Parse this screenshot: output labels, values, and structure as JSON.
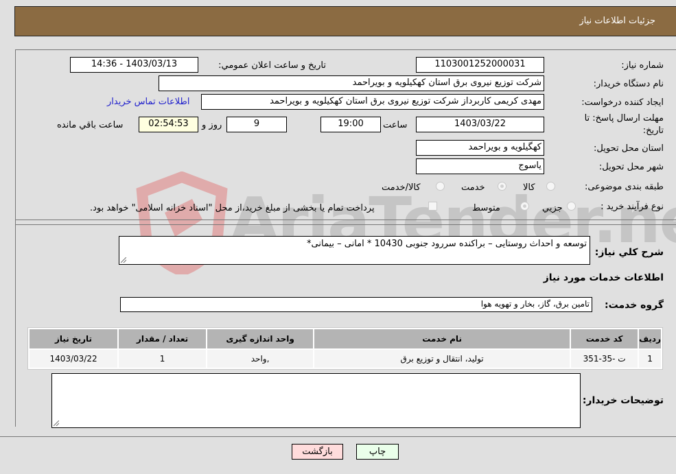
{
  "header": {
    "title": "جزئیات اطلاعات نیاز"
  },
  "form": {
    "need_number_label": "شماره نیاز:",
    "need_number": "1103001252000031",
    "announce_label": "تاریخ و ساعت اعلان عمومي:",
    "announce_value": "1403/03/13 - 14:36",
    "buyer_org_label": "نام دستگاه خریدار:",
    "buyer_org": "شرکت توزیع نیروی برق استان کهکیلویه و بویراحمد",
    "creator_label": "ایجاد کننده درخواست:",
    "creator": "مهدی کریمی کاربرداز شرکت توزیع نیروی برق استان کهکیلویه و بویراحمد",
    "contact_link": "اطلاعات تماس خریدار",
    "deadline_label_1": "مهلت ارسال پاسخ: تا",
    "deadline_label_2": "تاریخ:",
    "deadline_date": "1403/03/22",
    "time_label": "ساعت",
    "deadline_time": "19:00",
    "days_value": "9",
    "days_label": "روز و",
    "remaining_time": "02:54:53",
    "remaining_label": "ساعت باقي مانده",
    "province_label": "استان محل تحویل:",
    "province": "کهگیلویه و بویراحمد",
    "city_label": "شهر محل تحویل:",
    "city": "یاسوج",
    "category_label": "طبقه بندی موضوعی:",
    "category_options": [
      {
        "label": "کالا",
        "checked": false
      },
      {
        "label": "خدمت",
        "checked": true
      },
      {
        "label": "کالا/خدمت",
        "checked": false
      }
    ],
    "process_label": "نوع فرآیند خرید :",
    "process_options": [
      {
        "label": "جزيي",
        "checked": false
      },
      {
        "label": "متوسط",
        "checked": true
      }
    ],
    "treasury_note": "پرداخت تمام یا بخشی از مبلغ خرید،از محل \"اسناد خزانه اسلامی\" خواهد بود.",
    "description_label": "شرح کلي نیاز:",
    "description": "توسعه و احداث روستایی – براکنده سررود جنوبی 10430 * امانی – بیمانی*",
    "services_heading": "اطلاعات خدمات مورد نیاز",
    "service_group_label": "گروه خدمت:",
    "service_group": "تامین برق، گاز، بخار و تهویه هوا",
    "buyer_notes_label": "توضیحات خریدار:",
    "buyer_notes": ""
  },
  "table": {
    "headers": [
      "ردیف",
      "کد خدمت",
      "نام خدمت",
      "واحد اندازه گیری",
      "تعداد / مقدار",
      "تاریخ نیاز"
    ],
    "rows": [
      [
        "1",
        "ت -35-351",
        "تولید، انتقال و توزیع برق",
        ",واحد",
        "1",
        "1403/03/22"
      ]
    ]
  },
  "buttons": {
    "print": "چاپ",
    "back": "بازگشت"
  },
  "watermark": "AriaTender.neT"
}
